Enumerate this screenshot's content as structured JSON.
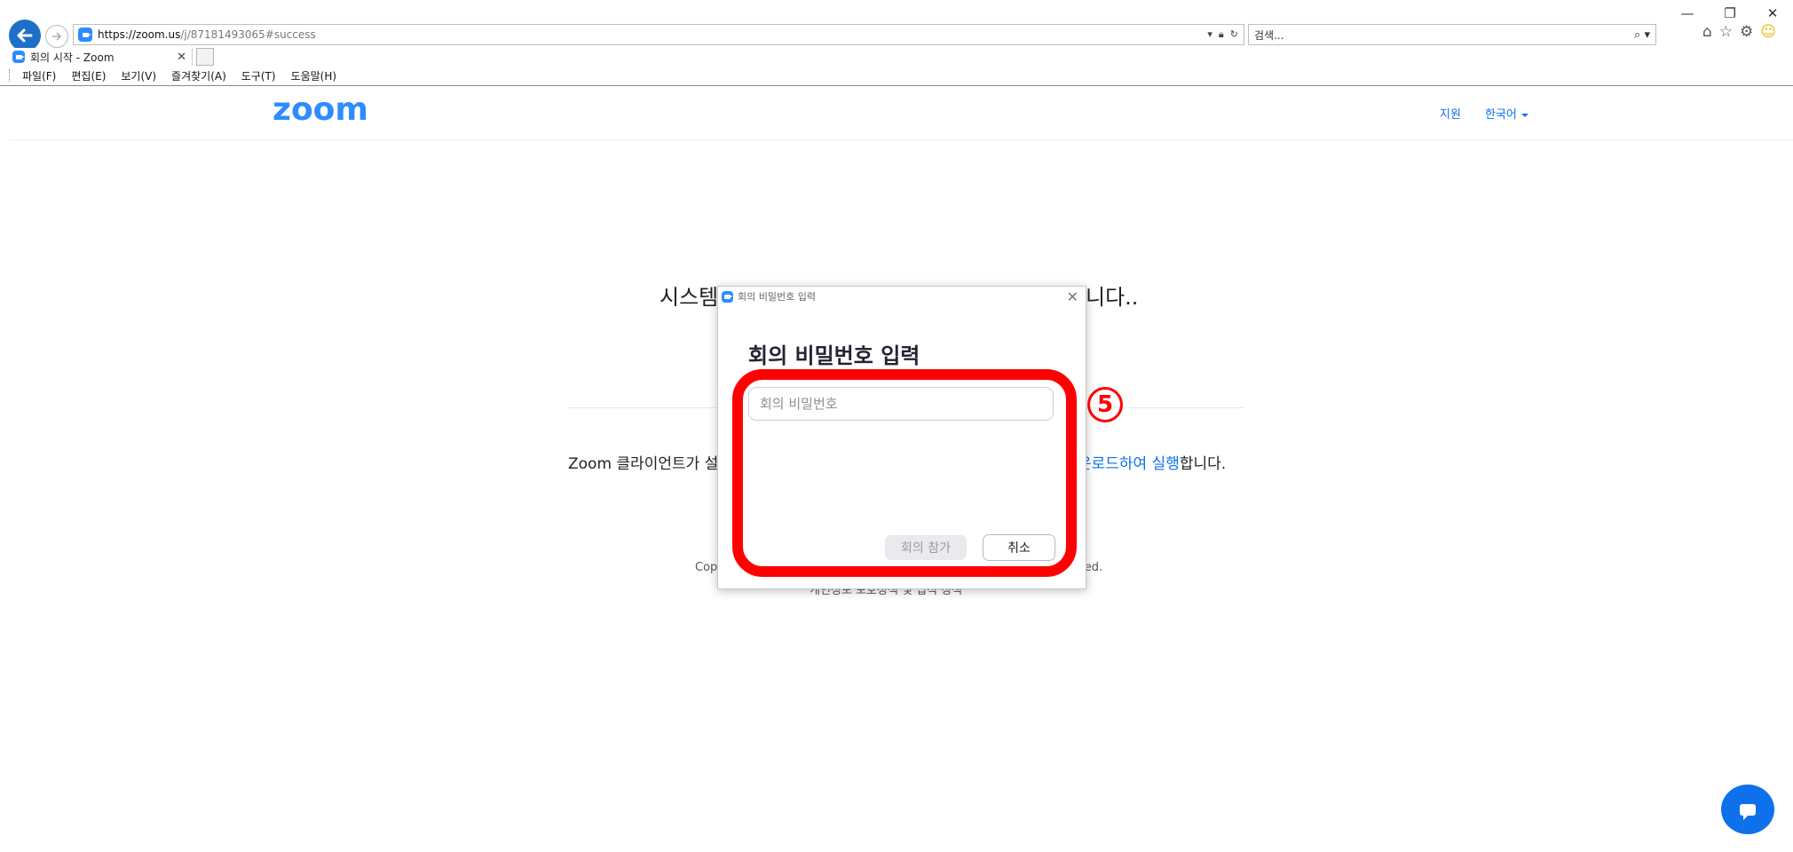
{
  "browser": {
    "window_controls": [
      "—",
      "❐",
      "✕"
    ],
    "url_host": "https://zoom.us",
    "url_path": "/j/87181493065#success",
    "search_placeholder": "검색...",
    "tab_title": "회의 시작 - Zoom",
    "menu": [
      "파일(F)",
      "편집(E)",
      "보기(V)",
      "즐겨찾기(A)",
      "도구(T)",
      "도움말(H)"
    ]
  },
  "header": {
    "logo": "zoom",
    "support": "지원",
    "language": "한국어"
  },
  "background": {
    "title_left": "시스템",
    "title_right": "니다..",
    "client_line_left": "Zoom 클라이언트가 설",
    "client_link": "운로드하여 실행",
    "client_tail": "합니다.",
    "copyright_left": "Cop",
    "copyright_right": "ved.",
    "legal": "개인정보 보호정책 및 법적 정책"
  },
  "dialog": {
    "window_title": "회의 비밀번호 입력",
    "heading": "회의 비밀번호 입력",
    "password_placeholder": "회의 비밀번호",
    "join_label": "회의 참가",
    "cancel_label": "취소"
  },
  "annotation": {
    "step_number": "5"
  },
  "colors": {
    "zoom_blue": "#2d8cff",
    "link_blue": "#0e71eb",
    "annotation_red": "#ff0000"
  }
}
